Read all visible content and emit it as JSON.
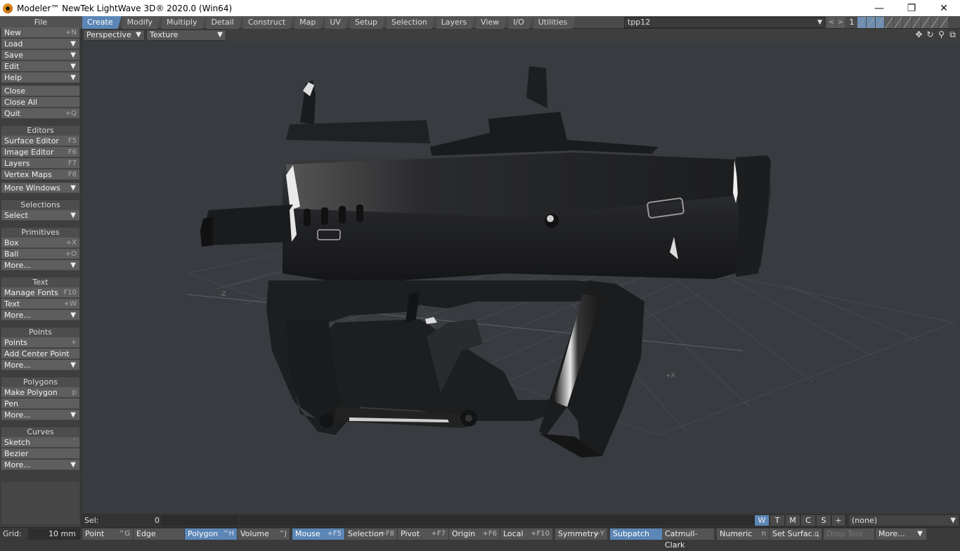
{
  "window": {
    "title": "Modeler™ NewTek LightWave 3D® 2020.0 (Win64)",
    "controls": {
      "minimize": "—",
      "restore": "❐",
      "close": "✕"
    }
  },
  "tabs": {
    "file_header": "File",
    "items": [
      "Create",
      "Modify",
      "Multiply",
      "Detail",
      "Construct",
      "Map",
      "UV",
      "Setup",
      "Selection",
      "Layers",
      "View",
      "I/O",
      "Utilities"
    ],
    "active": "Create"
  },
  "layers": {
    "object_name": "tpp12",
    "current_layer": "1",
    "nav_prev": "<",
    "nav_next": ">"
  },
  "sidebar": {
    "file": [
      {
        "label": "New",
        "shortcut": "+N"
      },
      {
        "label": "Load",
        "menu": true
      },
      {
        "label": "Save",
        "menu": true
      },
      {
        "label": "Edit",
        "menu": true
      },
      {
        "label": "Help",
        "menu": true
      }
    ],
    "file2": [
      {
        "label": "Close",
        "shortcut": ""
      },
      {
        "label": "Close All",
        "shortcut": ""
      },
      {
        "label": "Quit",
        "shortcut": "+Q"
      }
    ],
    "editors_header": "Editors",
    "editors": [
      {
        "label": "Surface Editor",
        "shortcut": "F5"
      },
      {
        "label": "Image Editor",
        "shortcut": "F6"
      },
      {
        "label": "Layers",
        "shortcut": "F7"
      },
      {
        "label": "Vertex Maps",
        "shortcut": "F8"
      }
    ],
    "more_windows": "More Windows",
    "selections_header": "Selections",
    "select": "Select",
    "primitives_header": "Primitives",
    "primitives": [
      {
        "label": "Box",
        "shortcut": "+X"
      },
      {
        "label": "Ball",
        "shortcut": "+O"
      }
    ],
    "primitives_more": "More...",
    "text_header": "Text",
    "text": [
      {
        "label": "Manage Fonts",
        "shortcut": "F10"
      },
      {
        "label": "Text",
        "shortcut": "+W"
      }
    ],
    "text_more": "More...",
    "points_header": "Points",
    "points": [
      {
        "label": "Points",
        "shortcut": "+"
      },
      {
        "label": "Add Center Point",
        "shortcut": ""
      }
    ],
    "points_more": "More...",
    "polygons_header": "Polygons",
    "polygons": [
      {
        "label": "Make Polygon",
        "shortcut": "p"
      },
      {
        "label": "Pen",
        "shortcut": ""
      }
    ],
    "polygons_more": "More...",
    "curves_header": "Curves",
    "curves": [
      {
        "label": "Sketch",
        "shortcut": "`"
      },
      {
        "label": "Bezier",
        "shortcut": ""
      }
    ],
    "curves_more": "More..."
  },
  "viewport": {
    "view_type": "Perspective",
    "render_mode": "Texture",
    "axis_x": "+X",
    "axis_z": "-Z"
  },
  "status": {
    "sel_label": "Sel:",
    "sel_count": "0",
    "wtmcs": [
      "W",
      "T",
      "M",
      "C",
      "S"
    ],
    "wtmcs_active": "W",
    "add": "+",
    "surface": "(none)"
  },
  "bottom": {
    "grid_label": "Grid:",
    "grid_value": "10 mm",
    "modes": [
      {
        "label": "Point",
        "shortcut": "^G"
      },
      {
        "label": "Edge",
        "shortcut": ""
      },
      {
        "label": "Polygon",
        "shortcut": "^H",
        "active": true
      },
      {
        "label": "Volume",
        "shortcut": "^J"
      }
    ],
    "actions": [
      {
        "label": "Mouse",
        "shortcut": "+F5",
        "active": true
      },
      {
        "label": "Selection",
        "shortcut": "+F8"
      },
      {
        "label": "Pivot",
        "shortcut": "+F7"
      },
      {
        "label": "Origin",
        "shortcut": "+F6"
      },
      {
        "label": "Local",
        "shortcut": "+F10"
      }
    ],
    "symmetry": {
      "label": "Symmetry",
      "shortcut": "+Y"
    },
    "subpatch": "Subpatch",
    "catmull": "Catmull-Clark",
    "numeric": {
      "label": "Numeric",
      "shortcut": "n"
    },
    "set_surface": {
      "label": "Set Surfac...",
      "shortcut": "q"
    },
    "drop_tool": "Drop Tool",
    "more": "More..."
  }
}
